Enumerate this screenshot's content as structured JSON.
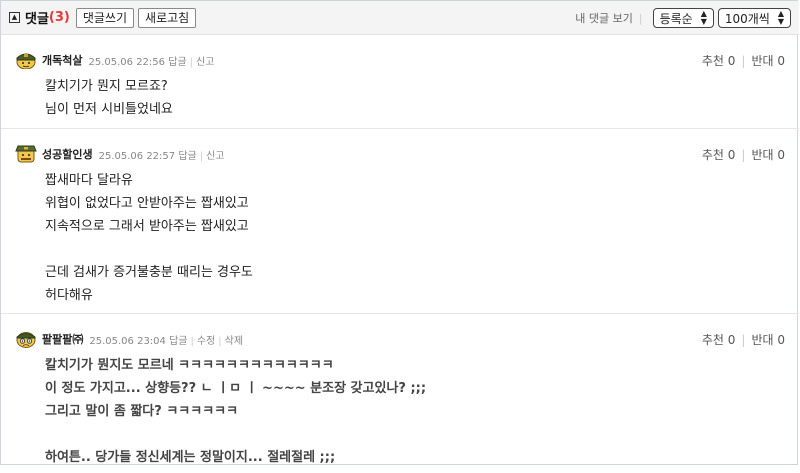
{
  "toolbar": {
    "toggle_glyph": "▲",
    "title": "댓글",
    "count": "(3)",
    "write_button": "댓글쓰기",
    "refresh_button": "새로고침",
    "view_label": "내 댓글 보기",
    "sort_select": "등록순",
    "per_page_select": "100개씩"
  },
  "comments": [
    {
      "nick": "개독척살",
      "time": "25.05.06 22:56",
      "actions": [
        "답글",
        "신고"
      ],
      "recommend": "추천 0",
      "oppose": "반대 0",
      "lines": [
        "칼치기가 뭔지 모르죠?",
        "님이 먼저 시비틀었네요"
      ]
    },
    {
      "nick": "성공할인생",
      "time": "25.05.06 22:57",
      "actions": [
        "답글",
        "신고"
      ],
      "recommend": "추천 0",
      "oppose": "반대 0",
      "lines": [
        "짭새마다 달라유",
        "위협이 없었다고 안받아주는 짭새있고",
        "지속적으로 그래서 받아주는 짭새있고",
        "",
        "근데 검새가 증거불충분 때리는 경우도",
        "허다해유"
      ]
    },
    {
      "nick": "팔팔팔㈜",
      "time": "25.05.06 23:04",
      "actions": [
        "답글",
        "수정",
        "삭제"
      ],
      "recommend": "추천 0",
      "oppose": "반대 0",
      "lines": [
        "칼치기가 뭔지도 모르네 ㅋㅋㅋㅋㅋㅋㅋㅋㅋㅋㅋㅋㅋ",
        "이 정도 가지고... 상향등?? ㄴ ㅣㅁ ㅣ ~~~~ 분조장 갖고있나? ;;;",
        "그리고 말이 좀 짧다? ㅋㅋㅋㅋㅋㅋ",
        "",
        "하여튼.. 당가들 정신세계는 정말이지... 절레절레 ;;;"
      ]
    }
  ]
}
